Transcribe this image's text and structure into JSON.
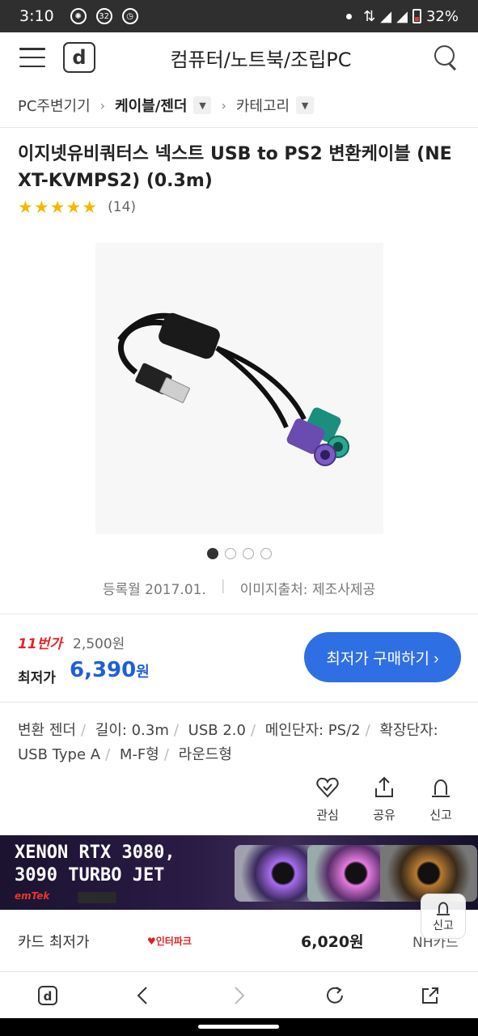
{
  "status": {
    "time": "3:10",
    "notif_badge": "32",
    "battery": "32%"
  },
  "header": {
    "title": "컴퓨터/노트북/조립PC",
    "logo_letter": "d"
  },
  "breadcrumb": {
    "level1": "PC주변기기",
    "level2": "케이블/젠더",
    "level3": "카테고리"
  },
  "product": {
    "title": "이지넷유비쿼터스 넥스트 USB to PS2 변환케이블 (NEXT-KVMPS2) (0.3m)",
    "rating": 4.5,
    "rating_stars": "★★★★★",
    "review_count": "(14)",
    "image_pages": 4,
    "image_active": 1,
    "registered": "등록월 2017.01.",
    "image_source": "이미지출처: 제조사제공"
  },
  "price": {
    "mall_name": "11번가",
    "mall_price": "2,500원",
    "lowest_label": "최저가",
    "lowest_value": "6,390",
    "currency": "원",
    "buy_button": "최저가 구매하기 ›"
  },
  "specs": [
    "변환 젠더",
    "길이: 0.3m",
    "USB 2.0",
    "메인단자: PS/2",
    "확장단자: USB Type A",
    "M-F형",
    "라운드형"
  ],
  "actions": {
    "favorite": "관심",
    "share": "공유",
    "report": "신고"
  },
  "banner": {
    "line1": "XENON RTX 3080,",
    "line2": "3090 TURBO JET",
    "brand": "emTek"
  },
  "floating": {
    "report": "신고"
  },
  "card_row": {
    "label": "카드 최저가",
    "mall": "인터파크",
    "price": "6,020원",
    "card": "NH카드"
  },
  "icons": {
    "bottom_nav": [
      "home-d-icon",
      "back-icon",
      "forward-icon",
      "refresh-icon",
      "share-out-icon"
    ]
  }
}
